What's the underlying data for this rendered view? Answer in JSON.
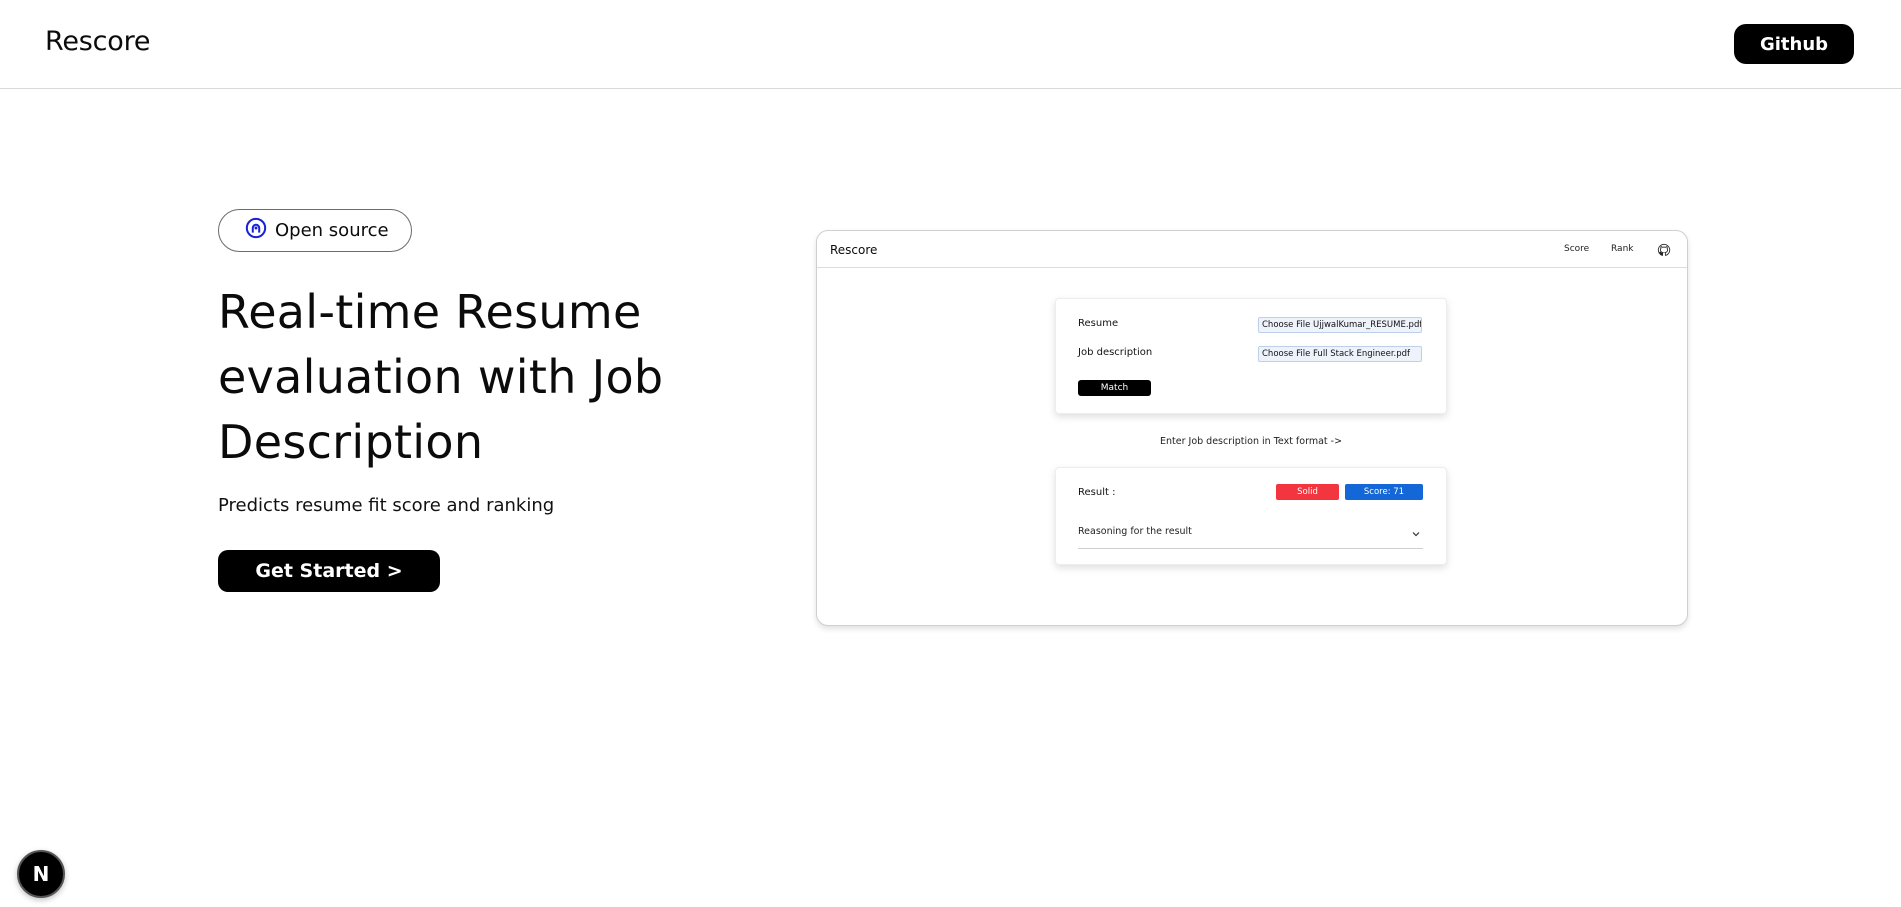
{
  "header": {
    "brand": "Rescore",
    "github_label": "Github"
  },
  "hero": {
    "badge_label": "Open source",
    "headline_lines": [
      "Real-time Resume",
      "evaluation with Job",
      "Description"
    ],
    "subheadline": "Predicts resume fit score and ranking",
    "cta_label": "Get Started >"
  },
  "preview": {
    "brand": "Rescore",
    "nav": [
      "Score",
      "Rank"
    ],
    "form": {
      "resume_label": "Resume",
      "resume_file": "Choose File UjjwalKumar_RESUME.pdf",
      "jd_label": "Job description",
      "jd_file": "Choose File Full Stack Engineer.pdf",
      "match_label": "Match"
    },
    "text_link": "Enter Job description in Text format ->",
    "result": {
      "label": "Result :",
      "verdict": "Solid",
      "score": "Score: 71",
      "reasoning_label": "Reasoning for the result"
    }
  },
  "next_badge": "N",
  "colors": {
    "accent_blue": "#1467d6",
    "accent_red": "#f2353f",
    "primary_button": "#000000"
  }
}
